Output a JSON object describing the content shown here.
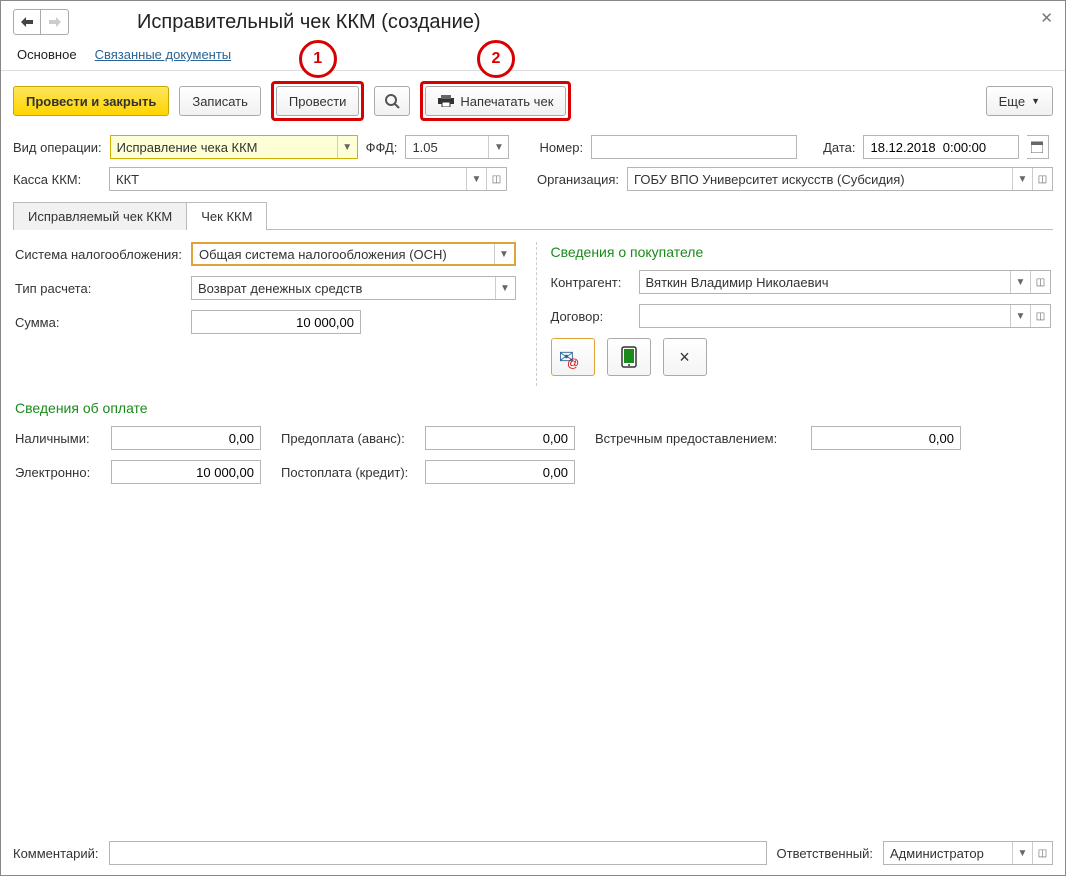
{
  "window": {
    "title": "Исправительный чек ККМ (создание)"
  },
  "top_tabs": {
    "main": "Основное",
    "related": "Связанные документы"
  },
  "toolbar": {
    "post_close": "Провести и закрыть",
    "save": "Записать",
    "post": "Провести",
    "print_check": "Напечатать чек",
    "more": "Еще"
  },
  "callouts": {
    "one": "1",
    "two": "2"
  },
  "fields": {
    "operation_type_label": "Вид операции:",
    "operation_type": "Исправление чека ККМ",
    "ffd_label": "ФФД:",
    "ffd": "1.05",
    "number_label": "Номер:",
    "number": "",
    "date_label": "Дата:",
    "date": "18.12.2018  0:00:00",
    "kassa_label": "Касса ККМ:",
    "kassa": "ККТ",
    "org_label": "Организация:",
    "org": "ГОБУ ВПО Университет искусств (Субсидия)"
  },
  "inner_tabs": {
    "corrected": "Исправляемый чек ККМ",
    "check": "Чек ККМ"
  },
  "check_form": {
    "tax_label": "Система налогообложения:",
    "tax": "Общая система налогообложения (ОСН)",
    "calc_type_label": "Тип расчета:",
    "calc_type": "Возврат денежных средств",
    "sum_label": "Сумма:",
    "sum": "10 000,00"
  },
  "buyer": {
    "section": "Сведения о покупателе",
    "contragent_label": "Контрагент:",
    "contragent": "Вяткин Владимир Николаевич",
    "contract_label": "Договор:",
    "contract": "",
    "close": "×"
  },
  "payment": {
    "section": "Сведения об оплате",
    "cash_label": "Наличными:",
    "cash": "0,00",
    "electronic_label": "Электронно:",
    "electronic": "10 000,00",
    "prepay_label": "Предоплата (аванс):",
    "prepay": "0,00",
    "postpay_label": "Постоплата (кредит):",
    "postpay": "0,00",
    "counter_label": "Встречным предоставлением:",
    "counter": "0,00"
  },
  "footer": {
    "comment_label": "Комментарий:",
    "comment": "",
    "responsible_label": "Ответственный:",
    "responsible": "Администратор"
  }
}
